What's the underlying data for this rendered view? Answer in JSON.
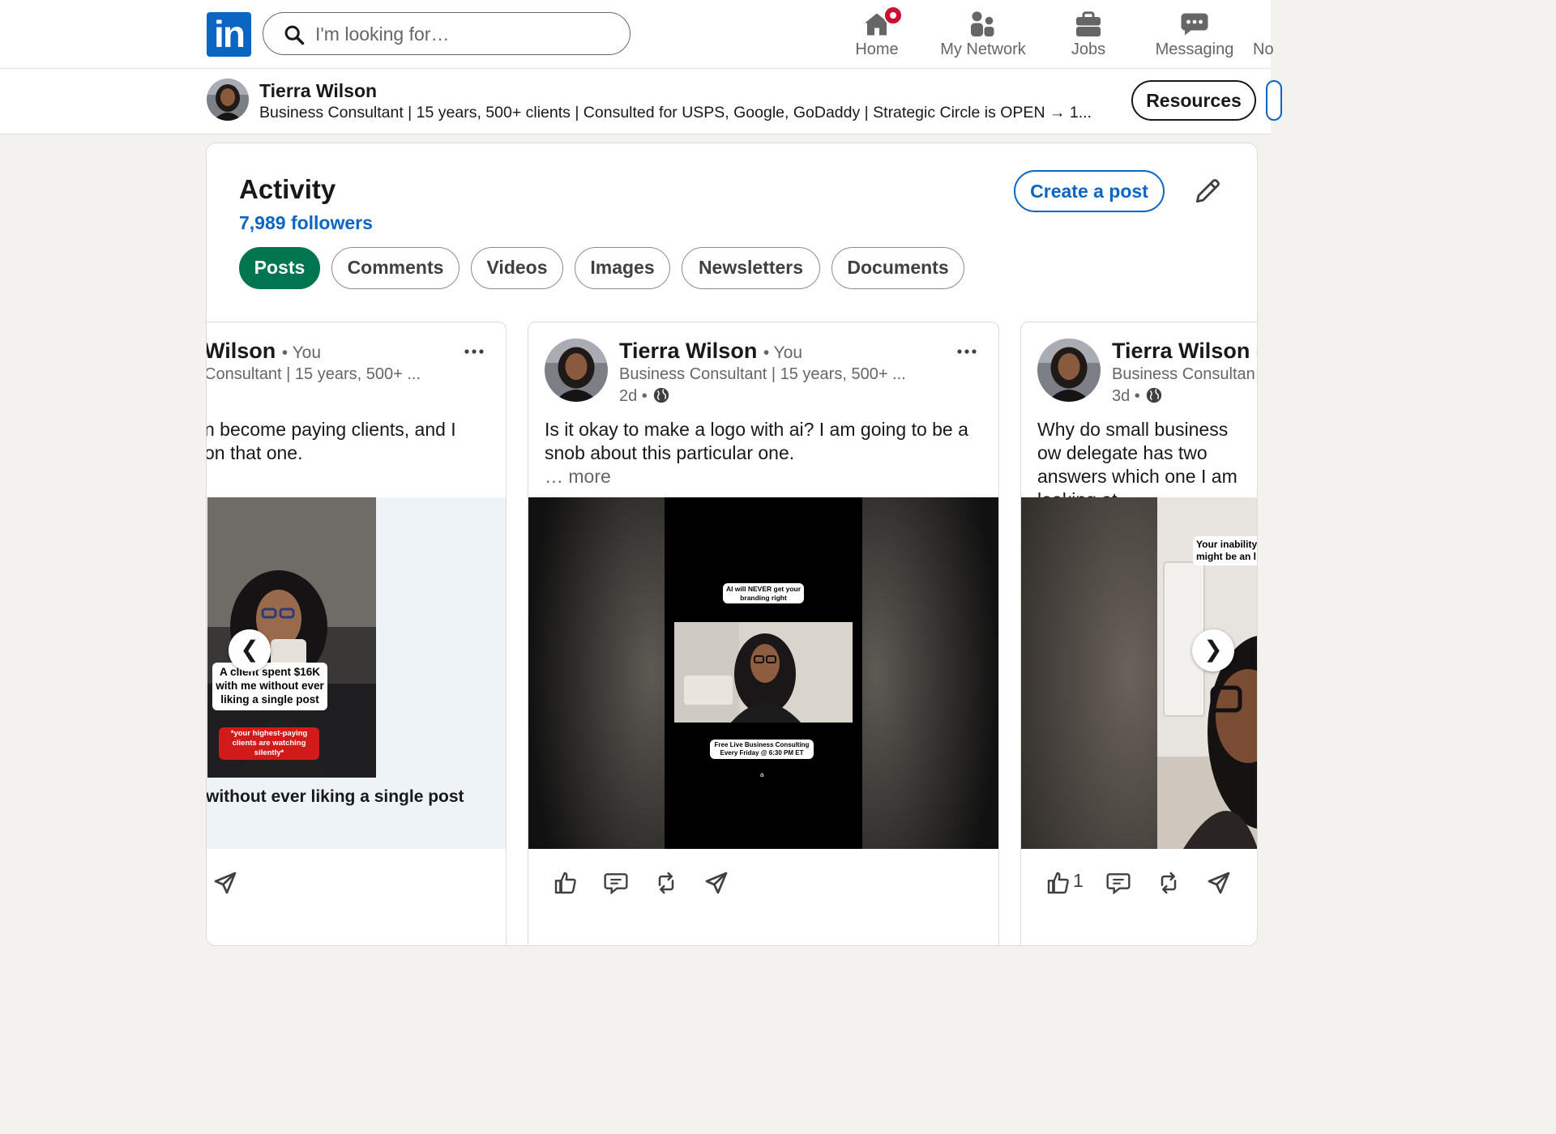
{
  "nav": {
    "logo_text": "in",
    "search_placeholder": "I'm looking for…",
    "items": [
      {
        "label": "Home",
        "icon": "home-icon"
      },
      {
        "label": "My Network",
        "icon": "network-icon"
      },
      {
        "label": "Jobs",
        "icon": "jobs-icon"
      },
      {
        "label": "Messaging",
        "icon": "messaging-icon"
      },
      {
        "label": "No",
        "icon": "notifications-icon"
      }
    ]
  },
  "profile_bar": {
    "name": "Tierra Wilson",
    "headline": "Business Consultant | 15 years, 500+ clients | Consulted for USPS, Google, GoDaddy | Strategic Circle is OPEN → 1...",
    "resources_label": "Resources"
  },
  "activity": {
    "title": "Activity",
    "followers": "7,989 followers",
    "create_post_label": "Create a post",
    "filters": [
      "Posts",
      "Comments",
      "Videos",
      "Images",
      "Newsletters",
      "Documents"
    ],
    "active_filter": "Posts"
  },
  "posts": [
    {
      "name": "Wilson",
      "you": "• You",
      "headline": "Consultant | 15 years, 500+ ...",
      "text": "n become paying clients, and I on that one.",
      "media_caption_main": "A client spent $16K with me without ever liking a single post",
      "media_caption_sub": "*your highest-paying clients are watching silently*",
      "footer_text": "without ever liking a single post",
      "reactions_count": ""
    },
    {
      "name": "Tierra Wilson",
      "you": "• You",
      "headline": "Business Consultant | 15 years, 500+ ...",
      "time": "2d •",
      "text": "Is it okay to make a logo with ai? I am going to be a snob about this particular one.",
      "more": "… more",
      "media_caption_top": "AI will NEVER get your branding right",
      "media_caption_bottom": "Free Live Business Consulting Every Friday @ 6:30 PM ET",
      "media_caption_tiny": "a",
      "reactions_count": ""
    },
    {
      "name": "Tierra Wilson",
      "you": "•",
      "headline": "Business Consultan",
      "time": "3d •",
      "text": "Why do small business ow delegate has two answers which one I am looking at",
      "media_caption_top": "Your inability might be an l",
      "reactions_count": "1"
    }
  ],
  "carousel": {
    "prev": "❮",
    "next": "❯"
  },
  "colors": {
    "brand": "#0a66c2",
    "active_pill": "#01754f",
    "notification": "#cb112d",
    "page_bg": "#f4f2ee"
  }
}
